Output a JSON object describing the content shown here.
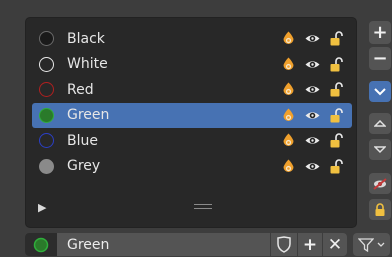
{
  "list": {
    "items": [
      {
        "label": "Black",
        "color": "#1a1a1a",
        "ring": "#6a6a6a",
        "selected": false
      },
      {
        "label": "White",
        "color": "#282828",
        "ring": "#e8e8e8",
        "selected": false
      },
      {
        "label": "Red",
        "color": "#282828",
        "ring": "#b02020",
        "selected": false
      },
      {
        "label": "Green",
        "color": "#2a7a2a",
        "ring": "#2fae3b",
        "selected": true
      },
      {
        "label": "Blue",
        "color": "#282828",
        "ring": "#2b3fc6",
        "selected": false
      },
      {
        "label": "Grey",
        "color": "#8a8a8a",
        "ring": "#8a8a8a",
        "selected": false
      }
    ],
    "row_icons": [
      "onion-skin-icon",
      "eye-icon",
      "lock-icon"
    ]
  },
  "side_buttons": [
    {
      "name": "add-button",
      "glyph": "+",
      "icon": "plus-icon"
    },
    {
      "name": "remove-button",
      "glyph": "−",
      "icon": "minus-icon"
    },
    {
      "name": "specials-menu-button",
      "glyph": "",
      "icon": "chevron-down-icon"
    },
    {
      "name": "move-up-button",
      "glyph": "",
      "icon": "triangle-up-icon"
    },
    {
      "name": "move-down-button",
      "glyph": "",
      "icon": "triangle-down-icon"
    },
    {
      "name": "hide-others-button",
      "glyph": "",
      "icon": "eye-slash-icon"
    },
    {
      "name": "lock-others-button",
      "glyph": "",
      "icon": "lock-icon"
    }
  ],
  "bottom": {
    "material_name": "Green",
    "new_label": "+",
    "unlink_label": "✕"
  },
  "colors": {
    "selected": "#4772b3",
    "panel": "#282828",
    "background": "#3d3d3d"
  }
}
